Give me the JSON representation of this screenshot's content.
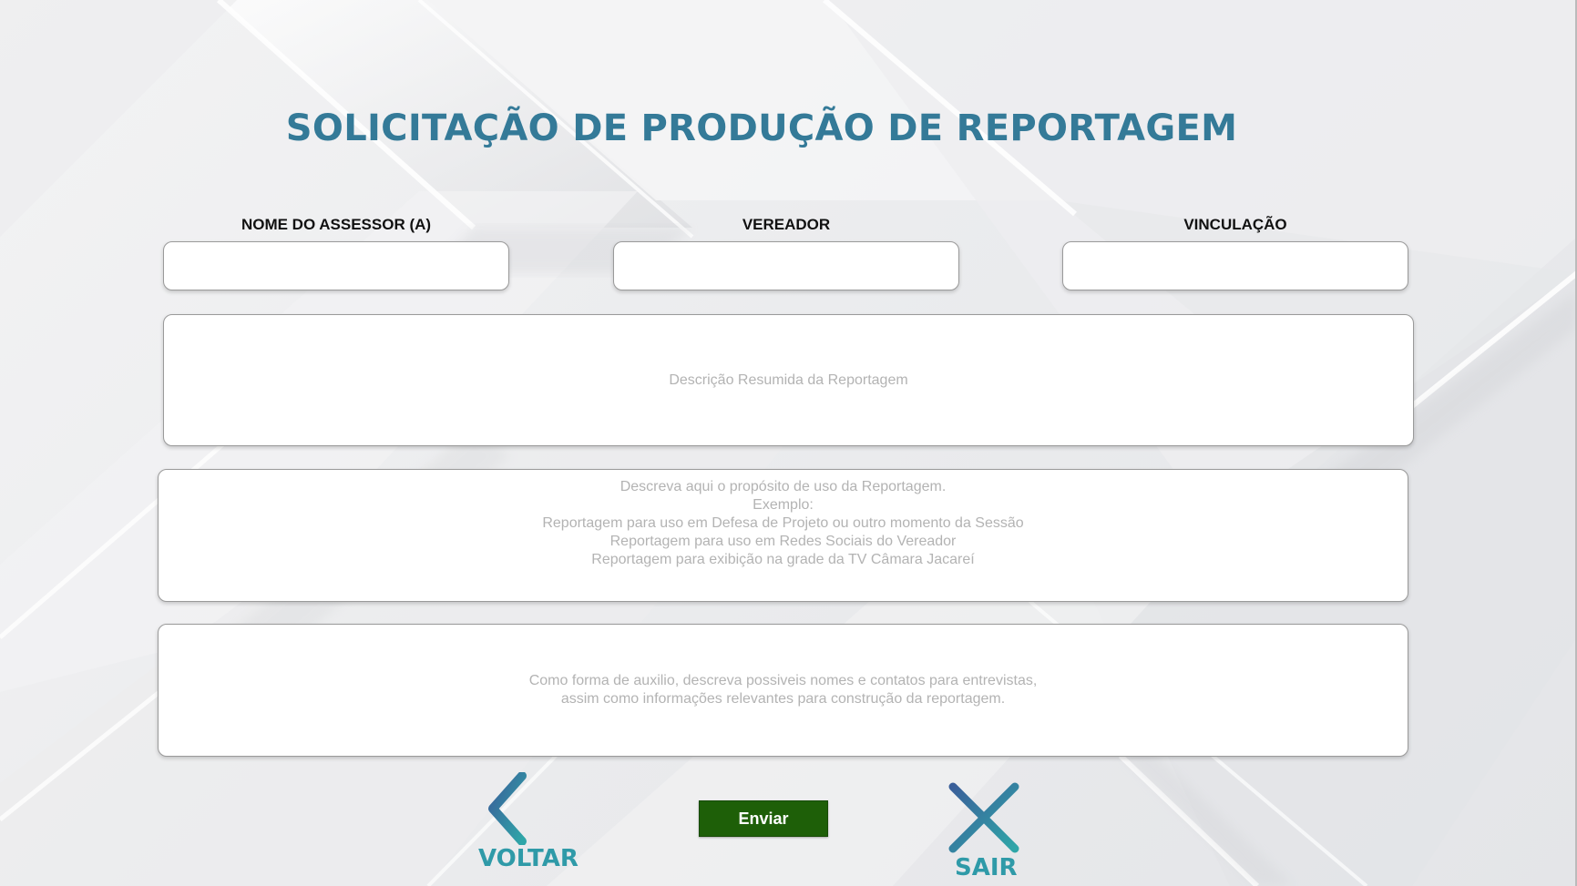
{
  "page": {
    "title": "SOLICITAÇÃO DE PRODUÇÃO DE REPORTAGEM"
  },
  "fields": {
    "assessor_label": "NOME DO ASSESSOR (A)",
    "assessor_value": "",
    "vereador_label": "VEREADOR",
    "vereador_value": "",
    "vinculacao_label": "VINCULAÇÃO",
    "vinculacao_value": ""
  },
  "descricao": {
    "placeholder": "Descrição Resumida da Reportagem"
  },
  "proposito": {
    "placeholder_lines": [
      "Descreva aqui o propósito de uso da Reportagem.",
      "Exemplo:",
      "Reportagem para uso em Defesa de Projeto ou outro momento da Sessão",
      "Reportagem para uso em Redes Sociais do Vereador",
      "Reportagem para exibição na grade da TV Câmara Jacareí"
    ]
  },
  "contatos": {
    "placeholder_lines": [
      "Como forma de auxilio, descreva possiveis nomes e contatos para entrevistas,",
      "assim como informações relevantes para construção da reportagem."
    ]
  },
  "actions": {
    "voltar_label": "VOLTAR",
    "voltar_icon": "chevron-left-icon",
    "enviar_label": "Enviar",
    "sair_label": "SAIR",
    "sair_icon": "close-icon"
  },
  "colors": {
    "title": "#347a98",
    "enviar_bg": "#1e5f08",
    "nav_label": "#2f9aa8",
    "icon_gradient_start": "#3a5f9a",
    "icon_gradient_end": "#2fa6a8"
  }
}
